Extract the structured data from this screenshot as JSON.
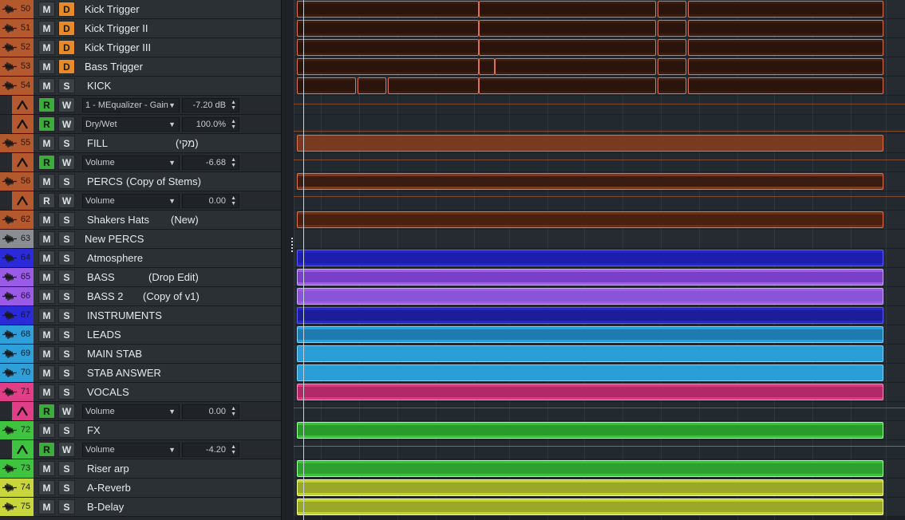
{
  "tracks": [
    {
      "kind": "audio",
      "number": "50",
      "name": "Kick Trigger",
      "btn2": "D",
      "color": "#b4582e"
    },
    {
      "kind": "audio",
      "number": "51",
      "name": "Kick Trigger II",
      "btn2": "D",
      "color": "#b4582e"
    },
    {
      "kind": "audio",
      "number": "52",
      "name": "Kick Trigger III",
      "btn2": "D",
      "color": "#b4582e"
    },
    {
      "kind": "audio",
      "number": "53",
      "name": "Bass Trigger",
      "btn2": "D",
      "color": "#b4582e"
    },
    {
      "kind": "audio",
      "number": "54",
      "name": "KICK",
      "btn2": "S",
      "color": "#b4582e"
    },
    {
      "kind": "auto",
      "param": "1 - MEqualizer - Gain",
      "value": "-7.20 dB",
      "color": "#b4582e"
    },
    {
      "kind": "auto",
      "param": "Dry/Wet",
      "value": "100.0%",
      "color": "#b4582e"
    },
    {
      "kind": "audio",
      "number": "55",
      "name": "FILL",
      "extra": "(מקי)",
      "btn2": "S",
      "color": "#b4582e"
    },
    {
      "kind": "auto",
      "param": "Volume",
      "value": "-6.68",
      "color": "#b4582e"
    },
    {
      "kind": "audio",
      "number": "56",
      "name": "PERCS",
      "extra": "(Copy of Stems)",
      "btn2": "S",
      "color": "#b4582e"
    },
    {
      "kind": "auto",
      "param": "Volume",
      "value": "0.00",
      "color": "#b4582e",
      "rdisabled": true
    },
    {
      "kind": "audio",
      "number": "62",
      "name": "Shakers Hats",
      "extra": "(New)",
      "btn2": "S",
      "color": "#b4582e"
    },
    {
      "kind": "audio",
      "number": "63",
      "name": "New PERCS",
      "btn2": "S",
      "color": "#8a8e92"
    },
    {
      "kind": "audio",
      "number": "64",
      "name": "Atmosphere",
      "btn2": "S",
      "color": "#2a2ad8"
    },
    {
      "kind": "audio",
      "number": "65",
      "name": "BASS",
      "extra": "(Drop Edit)",
      "btn2": "S",
      "color": "#9a5ce6"
    },
    {
      "kind": "audio",
      "number": "66",
      "name": "BASS 2",
      "extra": "(Copy of v1)",
      "btn2": "S",
      "color": "#9a5ce6"
    },
    {
      "kind": "audio",
      "number": "67",
      "name": "INSTRUMENTS",
      "btn2": "S",
      "color": "#2a2ad8"
    },
    {
      "kind": "audio",
      "number": "68",
      "name": "LEADS",
      "btn2": "S",
      "color": "#2e9fd8"
    },
    {
      "kind": "audio",
      "number": "69",
      "name": "MAIN STAB",
      "btn2": "S",
      "color": "#2e9fd8"
    },
    {
      "kind": "audio",
      "number": "70",
      "name": "STAB ANSWER",
      "btn2": "S",
      "color": "#2e9fd8"
    },
    {
      "kind": "audio",
      "number": "71",
      "name": "VOCALS",
      "btn2": "S",
      "color": "#e03f88"
    },
    {
      "kind": "auto",
      "param": "Volume",
      "value": "0.00",
      "color": "#e03f88"
    },
    {
      "kind": "audio",
      "number": "72",
      "name": "FX",
      "btn2": "S",
      "color": "#3fc43f"
    },
    {
      "kind": "auto",
      "param": "Volume",
      "value": "-4.20",
      "color": "#3fc43f"
    },
    {
      "kind": "audio",
      "number": "73",
      "name": "Riser arp",
      "btn2": "S",
      "color": "#3fc43f"
    },
    {
      "kind": "audio",
      "number": "74",
      "name": "A-Reverb",
      "btn2": "S",
      "color": "#c8d63c"
    },
    {
      "kind": "audio",
      "number": "75",
      "name": "B-Delay",
      "btn2": "S",
      "color": "#c8d63c"
    }
  ],
  "buttons": {
    "mute": "M",
    "read": "R",
    "write": "W"
  },
  "icons": {
    "audio": "waveform-icon",
    "automation": "automation-icon",
    "dropdown": "dropdown-arrow-icon"
  },
  "part_colors": {
    "orange_fill": "#3a1d12",
    "orange_border": "#e0714a",
    "atmosphere": "#2626c8",
    "bass": "#9b5fe0",
    "bass_dark": "#7a3fc8",
    "instruments": "#2828c0",
    "leads": "#2a9ed6",
    "vocals": "#d83a80",
    "fx": "#3cbf3c",
    "reverb": "#c2d236"
  }
}
